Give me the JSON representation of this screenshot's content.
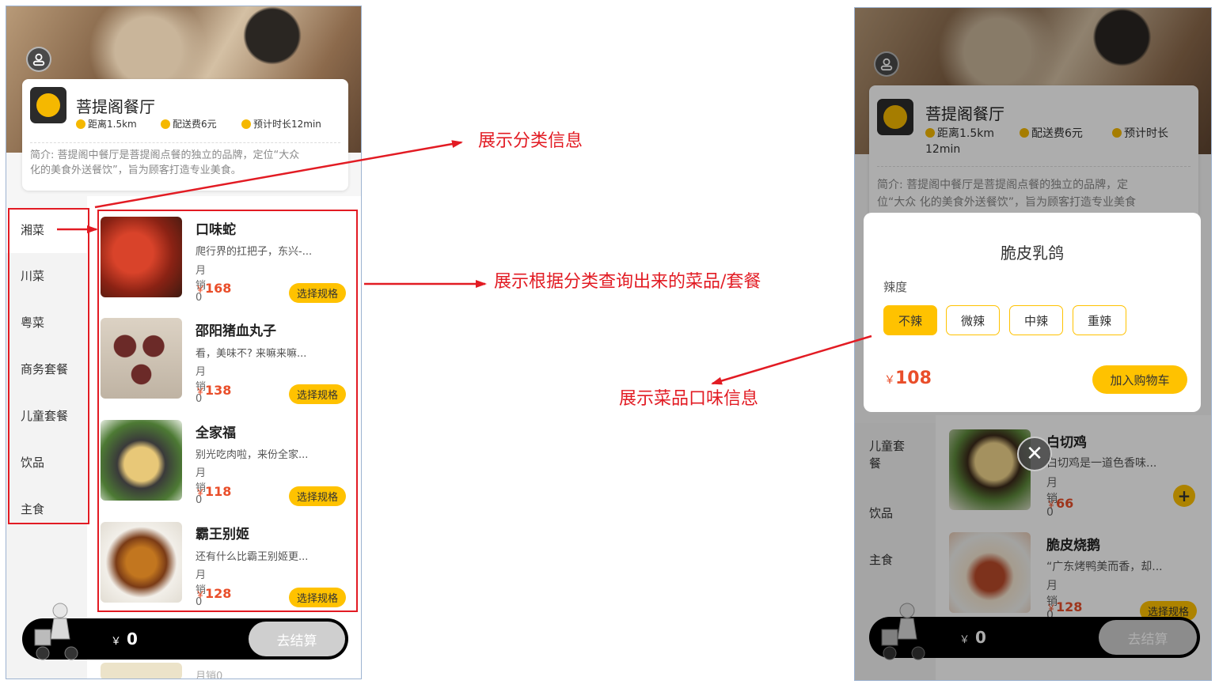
{
  "left_phone": {
    "shop": {
      "name": "菩提阁餐厅",
      "distance": "距离1.5km",
      "delivery_fee": "配送费6元",
      "time": "预计时长12min",
      "intro_line1": "简介: 菩提阁中餐厅是菩提阁点餐的独立的品牌，定位“大众",
      "intro_line2": "化的美食外送餐饮”，旨为顾客打造专业美食。"
    },
    "categories": [
      "湘菜",
      "川菜",
      "粤菜",
      "商务套餐",
      "儿童套餐",
      "饮品",
      "主食"
    ],
    "dishes": [
      {
        "name": "口味蛇",
        "desc": "爬行界的扛把子，东兴-...",
        "sales": "月销0",
        "currency": "￥",
        "price": "168",
        "button": "选择规格"
      },
      {
        "name": "邵阳猪血丸子",
        "desc": "看，美味不? 来嘛来嘛...",
        "sales": "月销0",
        "currency": "￥",
        "price": "138",
        "button": "选择规格"
      },
      {
        "name": "全家福",
        "desc": "别光吃肉啦，来份全家...",
        "sales": "月销0",
        "currency": "￥",
        "price": "118",
        "button": "选择规格"
      },
      {
        "name": "霸王别姬",
        "desc": "还有什么比霸王别姬更...",
        "sales": "月销0",
        "currency": "￥",
        "price": "128",
        "button": "选择规格"
      }
    ],
    "peek_sales": "月销0",
    "cart": {
      "currency": "￥",
      "total": "0",
      "checkout": "去结算"
    }
  },
  "right_phone": {
    "shop": {
      "name": "菩提阁餐厅",
      "distance": "距离1.5km",
      "delivery_fee": "配送费6元",
      "time_line1": "预计时长",
      "time_line2": "12min",
      "intro_line1": "简介: 菩提阁中餐厅是菩提阁点餐的独立的品牌，定",
      "intro_line2": "位“大众 化的美食外送餐饮”，旨为顾客打造专业美食"
    },
    "popup": {
      "title": "脆皮乳鸽",
      "flavor_label": "辣度",
      "flavors": [
        "不辣",
        "微辣",
        "中辣",
        "重辣"
      ],
      "selected_flavor": "不辣",
      "currency": "￥",
      "price": "108",
      "add_to_cart": "加入购物车"
    },
    "categories": [
      "儿童套餐",
      "饮品",
      "主食"
    ],
    "dishes": [
      {
        "name": "白切鸡",
        "desc": "白切鸡是一道色香味...",
        "sales": "月销0",
        "currency": "￥",
        "price": "66"
      },
      {
        "name": "脆皮烧鹅",
        "desc": "“广东烤鸭美而香，却...",
        "sales": "月销0",
        "currency": "￥",
        "price": "128",
        "button": "选择规格"
      }
    ],
    "plus_label": "+",
    "close_label": "✕",
    "cart": {
      "currency": "￥",
      "total": "0",
      "checkout": "去结算"
    }
  },
  "annotations": {
    "category_info": "展示分类信息",
    "dish_list": "展示根据分类查询出来的菜品/套餐",
    "flavor_info": "展示菜品口味信息"
  },
  "colors": {
    "accent_yellow": "#ffc200",
    "price_red": "#e94e2a",
    "annotation_red": "#e21b23"
  }
}
